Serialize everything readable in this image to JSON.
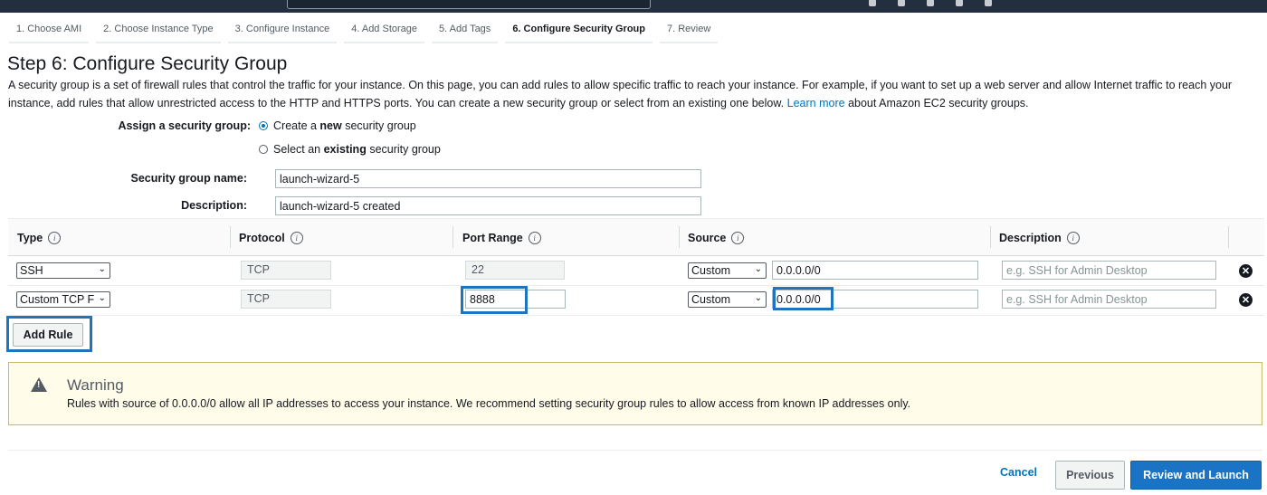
{
  "wizard": {
    "steps": [
      {
        "label": "1. Choose AMI"
      },
      {
        "label": "2. Choose Instance Type"
      },
      {
        "label": "3. Configure Instance"
      },
      {
        "label": "4. Add Storage"
      },
      {
        "label": "5. Add Tags"
      },
      {
        "label": "6. Configure Security Group",
        "active": true
      },
      {
        "label": "7. Review"
      }
    ]
  },
  "page": {
    "title": "Step 6: Configure Security Group",
    "intro_text": "A security group is a set of firewall rules that control the traffic for your instance. On this page, you can add rules to allow specific traffic to reach your instance. For example, if you want to set up a web server and allow Internet traffic to reach your instance, add rules that allow unrestricted access to the HTTP and HTTPS ports. You can create a new security group or select from an existing one below.",
    "learn_more": "Learn more",
    "intro_suffix": "about Amazon EC2 security groups."
  },
  "assign": {
    "label": "Assign a security group:",
    "option_new_pre": "Create a ",
    "option_new_bold": "new",
    "option_new_post": " security group",
    "option_existing_pre": "Select an ",
    "option_existing_bold": "existing",
    "option_existing_post": " security group",
    "selected": "new"
  },
  "group": {
    "name_label": "Security group name:",
    "name_value": "launch-wizard-5",
    "desc_label": "Description:",
    "desc_value": "launch-wizard-5 created"
  },
  "rules": {
    "headers": {
      "type": "Type",
      "protocol": "Protocol",
      "port_range": "Port Range",
      "source": "Source",
      "description": "Description"
    },
    "rows": [
      {
        "type": "SSH",
        "protocol": "TCP",
        "port": "22",
        "source_mode": "Custom",
        "source_cidr": "0.0.0.0/0",
        "desc_placeholder": "e.g. SSH for Admin Desktop"
      },
      {
        "type": "Custom TCP F",
        "protocol": "TCP",
        "port": "8888",
        "source_mode": "Custom",
        "source_cidr": "0.0.0.0/0",
        "desc_placeholder": "e.g. SSH for Admin Desktop"
      }
    ],
    "add_rule_label": "Add Rule"
  },
  "warning": {
    "title": "Warning",
    "text": "Rules with source of 0.0.0.0/0 allow all IP addresses to access your instance. We recommend setting security group rules to allow access from known IP addresses only."
  },
  "footer": {
    "cancel": "Cancel",
    "previous": "Previous",
    "review_launch": "Review and Launch"
  },
  "colors": {
    "accent": "#0073bb",
    "highlight": "#1f74bf",
    "primary_button": "#1a73c4",
    "warning_bg": "#fffce9"
  }
}
